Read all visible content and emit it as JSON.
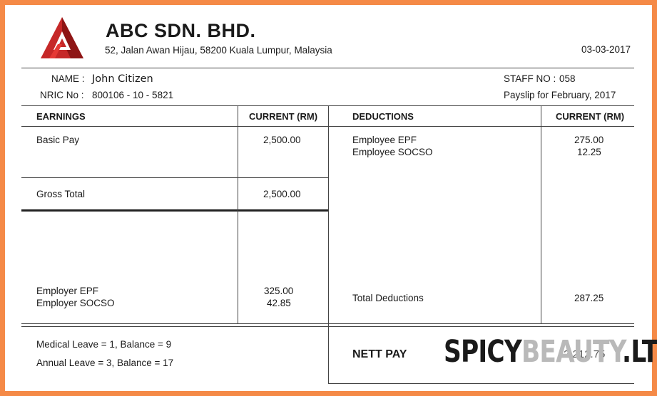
{
  "company": {
    "name": "ABC SDN. BHD.",
    "address": "52, Jalan Awan Hijau, 58200 Kuala Lumpur, Malaysia",
    "date": "03-03-2017",
    "logo_color": "#C62828"
  },
  "employee": {
    "name_label": "NAME :",
    "name": "John Citizen",
    "nric_label": "NRIC No :",
    "nric": "800106 - 10 - 5821",
    "staff_label": "STAFF NO :",
    "staff_no": "058",
    "period": "Payslip for February, 2017"
  },
  "earnings": {
    "header": "EARNINGS",
    "current_header": "CURRENT (RM)",
    "basic_label": "Basic Pay",
    "basic_value": "2,500.00",
    "gross_label": "Gross Total",
    "gross_value": "2,500.00",
    "employer_epf_label": "Employer EPF",
    "employer_epf_value": "325.00",
    "employer_socso_label": "Employer SOCSO",
    "employer_socso_value": "42.85"
  },
  "deductions": {
    "header": "DEDUCTIONS",
    "current_header": "CURRENT (RM)",
    "employee_epf_label": "Employee EPF",
    "employee_epf_value": "275.00",
    "employee_socso_label": "Employee SOCSO",
    "employee_socso_value": "12.25",
    "total_label": "Total Deductions",
    "total_value": "287.25"
  },
  "leave": {
    "medical": "Medical Leave = 1, Balance = 9",
    "annual": "Annual Leave = 3, Balance = 17"
  },
  "nett": {
    "label": "NETT PAY",
    "value": "2,212.75"
  },
  "watermark": {
    "part1": "SPICY",
    "part2": "BEAUTY",
    "part3": ".LT"
  }
}
